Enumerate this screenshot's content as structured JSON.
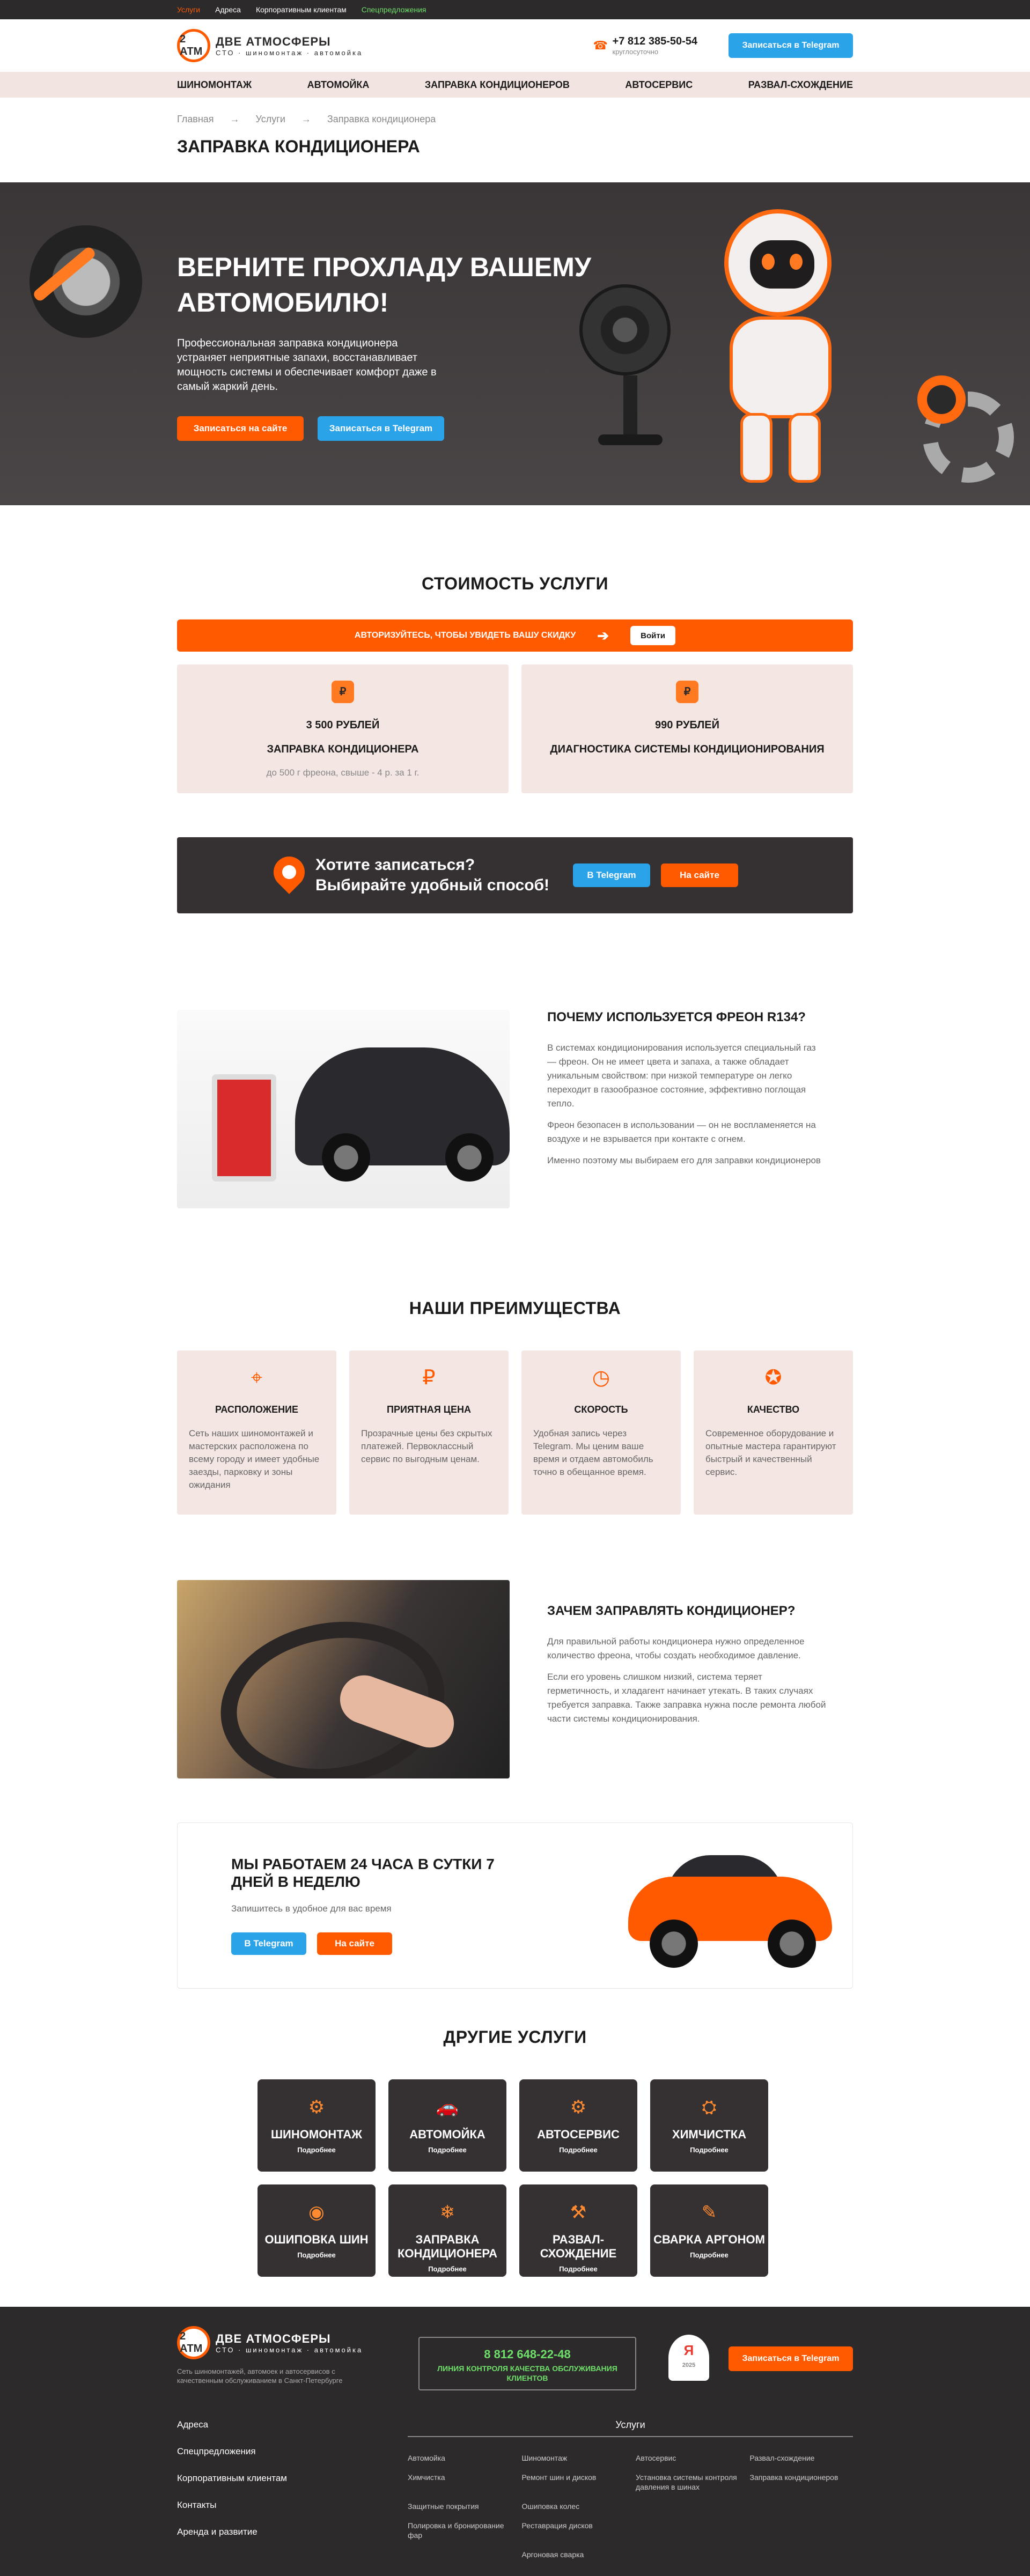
{
  "topbar": {
    "items": [
      "Услуги",
      "Адреса",
      "Корпоративным клиентам",
      "Спецпредложения"
    ]
  },
  "header": {
    "logo_badge": "2 АТМ",
    "logo_title": "ДВЕ АТМОСФЕРЫ",
    "logo_sub": "СТО · шиномонтаж · автомойка",
    "phone": "+7 812 385-50-54",
    "phone_sub": "круглосуточно",
    "telegram_btn": "Записаться в Telegram"
  },
  "nav": [
    "ШИНОМОНТАЖ",
    "АВТОМОЙКА",
    "ЗАПРАВКА КОНДИЦИОНЕРОВ",
    "АВТОСЕРВИС",
    "РАЗВАЛ-СХОЖДЕНИЕ"
  ],
  "breadcrumbs": [
    "Главная",
    "→",
    "Услуги",
    "→",
    "Заправка кондиционера"
  ],
  "page_title": "ЗАПРАВКА КОНДИЦИОНЕРА",
  "hero": {
    "title": "ВЕРНИТЕ ПРОХЛАДУ ВАШЕМУ АВТОМОБИЛЮ!",
    "text": "Профессиональная заправка кондиционера устраняет неприятные запахи, восстанавливает мощность системы и обеспечивает комфорт даже в самый жаркий день.",
    "btn_site": "Записаться на сайте",
    "btn_tg": "Записаться в Telegram"
  },
  "pricing": {
    "title": "СТОИМОСТЬ УСЛУГИ",
    "auth_text": "АВТОРИЗУЙТЕСЬ, ЧТОБЫ УВИДЕТЬ ВАШУ СКИДКУ",
    "login": "Войти",
    "arrow": "➔",
    "cards": [
      {
        "icon": "₽",
        "price": "3 500 РУБЛЕЙ",
        "name": "ЗАПРАВКА КОНДИЦИОНЕРА",
        "sub": "до 500 г фреона, свыше - 4 р. за 1 г."
      },
      {
        "icon": "₽",
        "price": "990 РУБЛЕЙ",
        "name": "ДИАГНОСТИКА СИСТЕМЫ КОНДИЦИОНИРОВАНИЯ",
        "sub": ""
      }
    ]
  },
  "signup": {
    "line1": "Хотите записаться?",
    "line2": "Выбирайте удобный способ!",
    "btn_tg": "В Telegram",
    "btn_site": "На сайте"
  },
  "freon": {
    "title": "ПОЧЕМУ ИСПОЛЬЗУЕТСЯ ФРЕОН R134?",
    "p1": "В системах кондиционирования используется специальный газ — фреон. Он не имеет цвета и запаха, а также обладает уникальным свойством: при низкой температуре он легко переходит в газообразное состояние, эффективно поглощая тепло.",
    "p2": "Фреон безопасен в использовании — он не воспламеняется на воздухе и не взрывается при контакте с огнем.",
    "p3": "Именно поэтому мы выбираем его для заправки кондиционеров"
  },
  "advantages": {
    "title": "НАШИ ПРЕИМУЩЕСТВА",
    "items": [
      {
        "icon": "⌖",
        "title": "РАСПОЛОЖЕНИЕ",
        "text": "Сеть наших шиномонтажей и мастерских расположена по всему городу и имеет удобные заезды, парковку и зоны ожидания"
      },
      {
        "icon": "₽",
        "title": "ПРИЯТНАЯ ЦЕНА",
        "text": "Прозрачные цены без скрытых платежей. Первоклассный сервис по выгодным ценам."
      },
      {
        "icon": "◷",
        "title": "СКОРОСТЬ",
        "text": "Удобная запись через Telegram. Мы ценим ваше время и отдаем автомобиль точно в обещанное время."
      },
      {
        "icon": "✪",
        "title": "КАЧЕСТВО",
        "text": "Современное оборудование и опытные мастера гарантируют быстрый и качественный сервис."
      }
    ]
  },
  "why": {
    "title": "ЗАЧЕМ ЗАПРАВЛЯТЬ КОНДИЦИОНЕР?",
    "p1": "Для правильной работы кондиционера нужно определенное количество фреона, чтобы создать необходимое давление.",
    "p2": "Если его уровень слишком низкий, система теряет герметичность, и хладагент начинает утекать. В таких случаях требуется заправка. Также заправка нужна после ремонта любой части системы кондиционирования."
  },
  "allday": {
    "title": "МЫ РАБОТАЕМ 24 ЧАСА В СУТКИ 7 ДНЕЙ В НЕДЕЛЮ",
    "sub": "Запишитесь в удобное для вас время",
    "btn_tg": "В Telegram",
    "btn_site": "На сайте"
  },
  "services": {
    "title": "ДРУГИЕ УСЛУГИ",
    "more": "Подробнее",
    "items": [
      {
        "icon": "⚙",
        "name": "ШИНОМОНТАЖ"
      },
      {
        "icon": "🚗",
        "name": "АВТОМОЙКА"
      },
      {
        "icon": "⚙",
        "name": "АВТОСЕРВИС"
      },
      {
        "icon": "⛭",
        "name": "ХИМЧИСТКА"
      },
      {
        "icon": "◉",
        "name": "ОШИПОВКА ШИН"
      },
      {
        "icon": "❄",
        "name": "ЗАПРАВКА КОНДИЦИОНЕРА"
      },
      {
        "icon": "⚒",
        "name": "РАЗВАЛ-СХОЖДЕНИЕ"
      },
      {
        "icon": "✎",
        "name": "СВАРКА АРГОНОМ"
      }
    ]
  },
  "footer": {
    "logo_title": "ДВЕ АТМОСФЕРЫ",
    "logo_sub": "СТО · шиномонтаж · автомойка",
    "desc": "Сеть шиномонтажей, автомоек и автосервисов с качественным обслуживанием в Санкт-Петербурге",
    "phone": "8 812 648-22-48",
    "phone_sub": "ЛИНИЯ КОНТРОЛЯ КАЧЕСТВА ОБСЛУЖИВАНИЯ КЛИЕНТОВ",
    "ya": "Я",
    "ya_year": "2025",
    "telegram_btn": "Записаться в Telegram",
    "links": [
      "Адреса",
      "Спецпредложения",
      "Корпоративным клиентам",
      "Контакты",
      "Аренда и развитие"
    ],
    "services_title": "Услуги",
    "services": [
      "Автомойка",
      "Шиномонтаж",
      "Автосервис",
      "Развал-схождение",
      "Химчистка",
      "Ремонт шин и дисков",
      "Установка системы контроля давления в шинах",
      "Заправка кондиционеров",
      "Защитные покрытия",
      "Ошиповка колес",
      "",
      "",
      "Полировка и бронирование фар",
      "Реставрация дисков",
      "",
      "",
      "",
      "Аргоновая сварка",
      "",
      ""
    ]
  },
  "colors": {
    "accent": "#ff5a00",
    "telegram": "#2aa3e8",
    "dark": "#2d2a2b",
    "card": "#f4e6e3",
    "green": "#6ee06a"
  }
}
